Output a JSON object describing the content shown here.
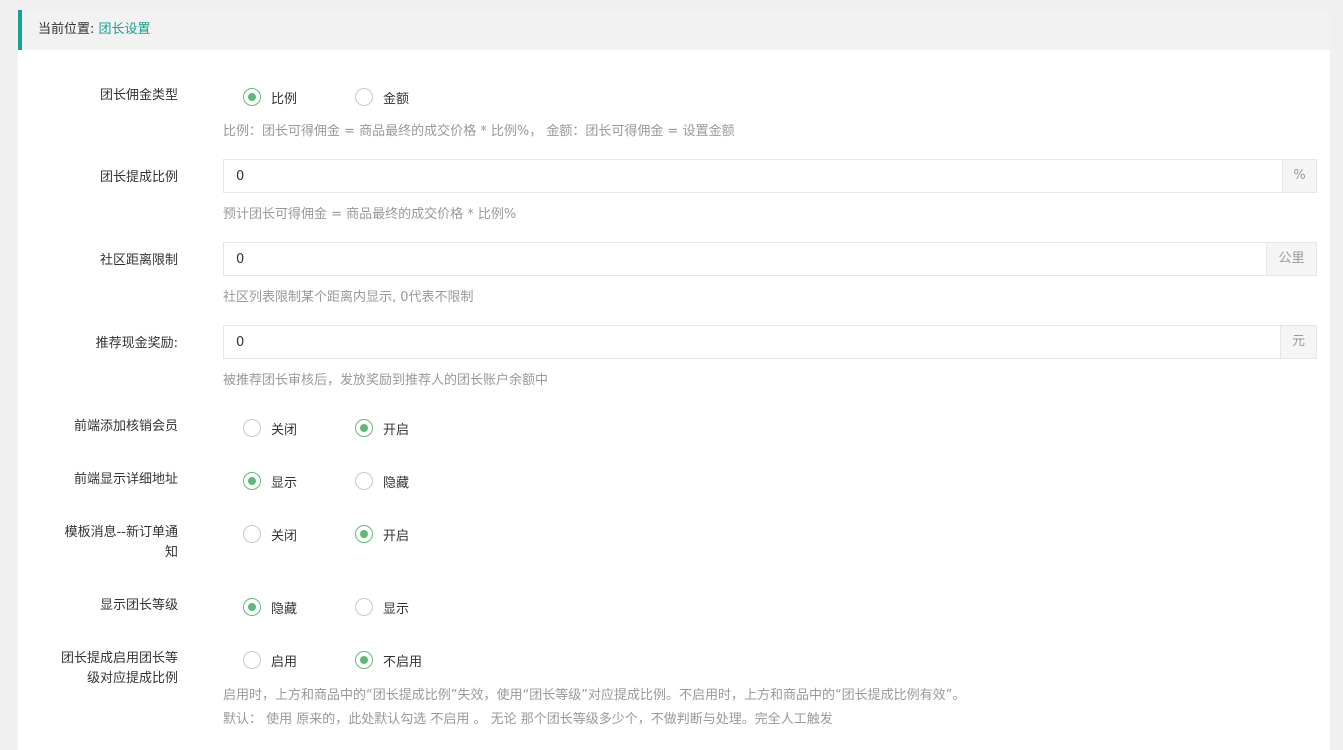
{
  "breadcrumb": {
    "prefix": "当前位置:",
    "current": "团长设置"
  },
  "fields": {
    "commission_type": {
      "label": "团长佣金类型",
      "options": [
        "比例",
        "金额"
      ],
      "help": "比例：团长可得佣金 = 商品最终的成交价格 * 比例%， 金额：团长可得佣金 = 设置金额"
    },
    "commission_ratio": {
      "label": "团长提成比例",
      "value": "0",
      "unit": "%",
      "help": "预计团长可得佣金 = 商品最终的成交价格 * 比例%"
    },
    "distance_limit": {
      "label": "社区距离限制",
      "value": "0",
      "unit": "公里",
      "help": "社区列表限制某个距离内显示, 0代表不限制"
    },
    "referral_reward": {
      "label": "推荐现金奖励:",
      "value": "0",
      "unit": "元",
      "help": "被推荐团长审核后，发放奖励到推荐人的团长账户余额中"
    },
    "add_verifier": {
      "label": "前端添加核销会员",
      "options": [
        "关闭",
        "开启"
      ]
    },
    "show_address": {
      "label": "前端显示详细地址",
      "options": [
        "显示",
        "隐藏"
      ]
    },
    "template_msg": {
      "label_line1": "模板消息--新订单通",
      "label_line2": "知",
      "options": [
        "关闭",
        "开启"
      ]
    },
    "show_level": {
      "label": "显示团长等级",
      "options": [
        "隐藏",
        "显示"
      ]
    },
    "level_ratio": {
      "label_line1": "团长提成启用团长等",
      "label_line2": "级对应提成比例",
      "options": [
        "启用",
        "不启用"
      ],
      "help_line1": "启用时，上方和商品中的“团长提成比例”失效，使用“团长等级”对应提成比例。不启用时，上方和商品中的“团长提成比例有效”。",
      "help_line2": "默认： 使用 原来的，此处默认勾选 不启用 。 无论 那个团长等级多少个，不做判断与处理。完全人工触发"
    }
  },
  "colors": {
    "accent": "#1aa094",
    "radio_checked": "#5fb878"
  }
}
